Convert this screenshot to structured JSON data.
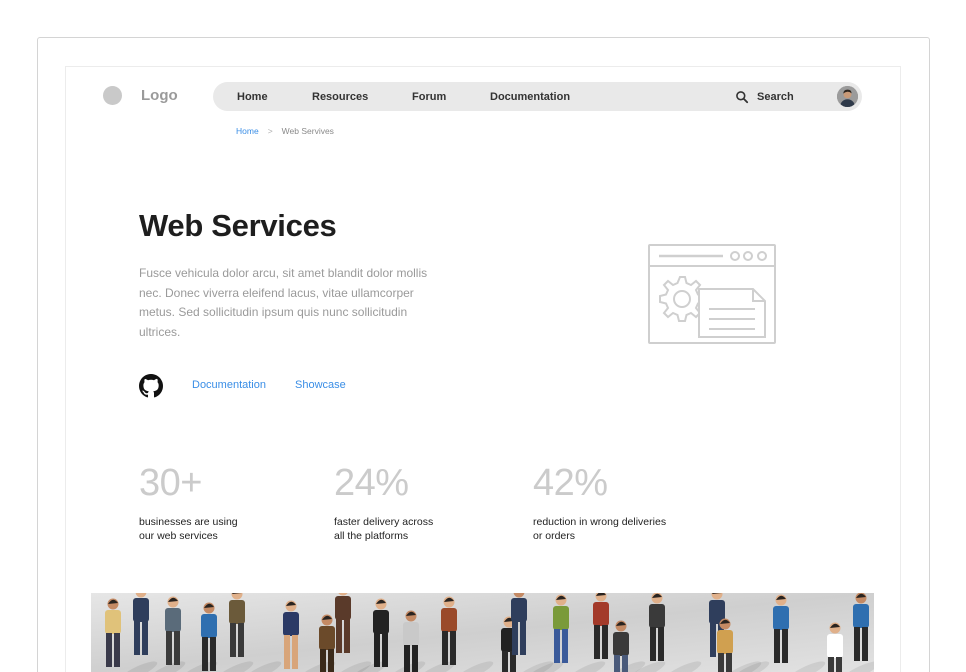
{
  "logo": {
    "text": "Logo"
  },
  "nav": {
    "items": [
      {
        "label": "Home"
      },
      {
        "label": "Resources"
      },
      {
        "label": "Forum"
      },
      {
        "label": "Documentation"
      }
    ],
    "search_label": "Search"
  },
  "breadcrumb": {
    "home": "Home",
    "separator": ">",
    "current": "Web Servives"
  },
  "hero": {
    "title": "Web Services",
    "description": "Fusce vehicula dolor arcu, sit amet blandit dolor mollis nec. Donec viverra eleifend lacus, vitae ullamcorper metus. Sed sollicitudin ipsum quis nunc sollicitudin ultrices.",
    "links": {
      "documentation": "Documentation",
      "showcase": "Showcase"
    }
  },
  "stats": [
    {
      "value": "30+",
      "label_line1": "businesses are using",
      "label_line2": "our web services"
    },
    {
      "value": "24%",
      "label_line1": "faster delivery across",
      "label_line2": "all the platforms"
    },
    {
      "value": "42%",
      "label_line1": "reduction in wrong deliveries",
      "label_line2": "or orders"
    }
  ],
  "icons": [
    "search-icon",
    "github-icon",
    "web-service-illustration-icon",
    "avatar"
  ],
  "colors": {
    "link": "#3a8ee6",
    "stat_value": "#cbcbcb",
    "nav_bg": "#e9e9e9"
  }
}
